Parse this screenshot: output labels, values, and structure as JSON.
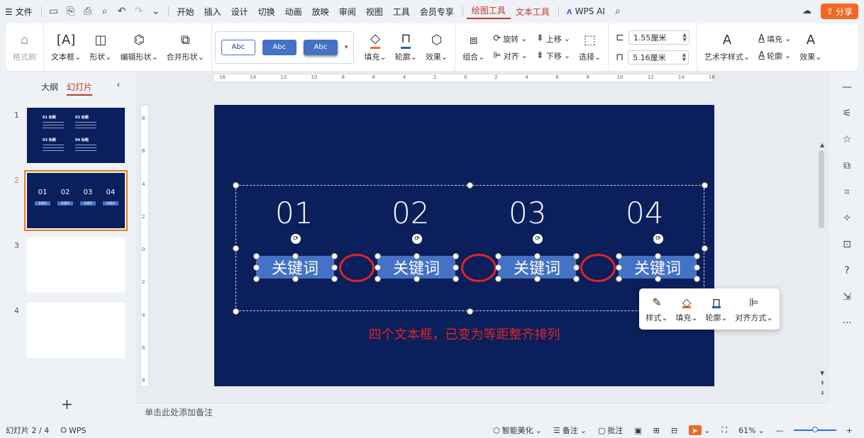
{
  "menubar": {
    "file_label": "文件",
    "tabs": [
      "开始",
      "插入",
      "设计",
      "切换",
      "动画",
      "放映",
      "审阅",
      "视图",
      "工具",
      "会员专享"
    ],
    "context_tabs": [
      "绘图工具",
      "文本工具"
    ],
    "active_tab": "绘图工具",
    "ai_label": "WPS AI",
    "share_label": "分享"
  },
  "ribbon": {
    "format_painter": "格式刷",
    "textbox": "文本框",
    "shape": "形状",
    "edit_shape": "编辑形状",
    "merge_shape": "合并形状",
    "style_swatches": [
      "Abc",
      "Abc",
      "Abc"
    ],
    "fill": "填充",
    "outline": "轮廓",
    "effect": "效果",
    "group": "组合",
    "rotate": "旋转",
    "align": "对齐",
    "move_up": "上移",
    "move_down": "下移",
    "select": "选择",
    "height_value": "1.55厘米",
    "width_value": "5.16厘米",
    "art_style": "艺术字样式",
    "text_fill": "填充",
    "text_outline": "轮廓",
    "text_effect": "效果"
  },
  "left_panel": {
    "tab_outline": "大纲",
    "tab_slides": "幻灯片",
    "slide_numbers": [
      "1",
      "2",
      "3",
      "4"
    ],
    "thumb1_titles": [
      "01 标题",
      "02 标题",
      "03 标题",
      "04 标题"
    ],
    "thumb2_nums": [
      "01",
      "02",
      "03",
      "04"
    ],
    "thumb2_kw": "关键词"
  },
  "ruler": {
    "h_ticks": [
      "16",
      "14",
      "12",
      "10",
      "8",
      "6",
      "4",
      "2",
      "0",
      "2",
      "4",
      "6",
      "8",
      "10",
      "12",
      "14",
      "16"
    ],
    "v_ticks": [
      "8",
      "6",
      "4",
      "2",
      "0",
      "2",
      "4",
      "6",
      "8"
    ]
  },
  "slide": {
    "numbers": [
      "01",
      "02",
      "03",
      "04"
    ],
    "keyword": "关键词",
    "annotation": "四个文本框，已变为等距整齐排列",
    "colors": {
      "background": "#0b1f5c",
      "box": "#4472c4",
      "ellipse": "#e02424"
    }
  },
  "float_toolbar": {
    "style": "样式",
    "fill": "填充",
    "outline": "轮廓",
    "align": "对齐方式"
  },
  "notes_placeholder": "单击此处添加备注",
  "statusbar": {
    "slide_counter": "幻灯片 2 / 4",
    "wps_label": "WPS",
    "smart_beautify": "智能美化",
    "notes": "备注",
    "comments": "批注",
    "zoom": "61%",
    "zoom_fraction": 0.61
  },
  "icons": {
    "brand": "#f06a24",
    "accent": "#c0392b"
  }
}
